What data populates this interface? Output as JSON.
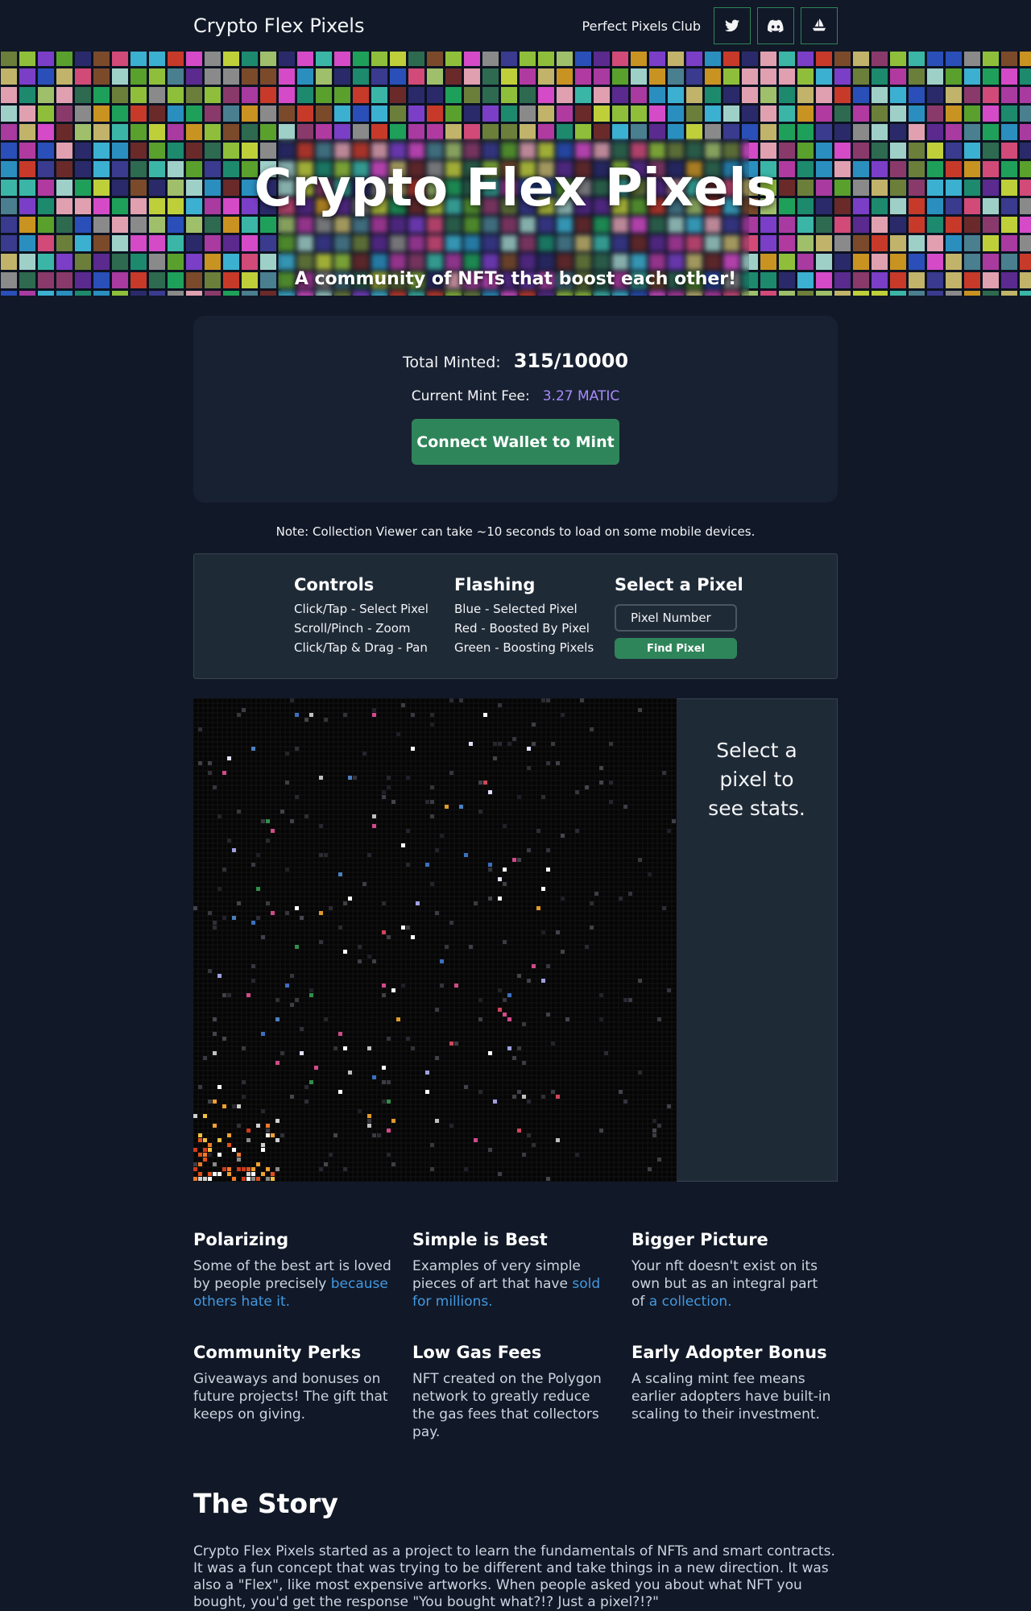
{
  "nav": {
    "brand": "Crypto Flex Pixels",
    "club_label": "Perfect Pixels Club",
    "icons": [
      "twitter-icon",
      "discord-icon",
      "opensea-icon"
    ]
  },
  "hero": {
    "title": "Crypto Flex Pixels",
    "subtitle": "A community of NFTs that boost each other!"
  },
  "mint": {
    "total_label": "Total Minted:",
    "total_value": "315/10000",
    "fee_label": "Current Mint Fee:",
    "fee_value": "3.27 MATIC",
    "button_label": "Connect Wallet to Mint"
  },
  "note": "Note: Collection Viewer can take ~10 seconds to load on some mobile devices.",
  "controls": {
    "controls_title": "Controls",
    "controls_items": [
      "Click/Tap - Select Pixel",
      "Scroll/Pinch - Zoom",
      "Click/Tap & Drag - Pan"
    ],
    "flashing_title": "Flashing",
    "flashing_items": [
      "Blue - Selected Pixel",
      "Red - Boosted By Pixel",
      "Green - Boosting Pixels"
    ],
    "select_title": "Select a Pixel",
    "input_placeholder": "Pixel Number",
    "find_label": "Find Pixel"
  },
  "viewer": {
    "stats_placeholder": "Select a pixel to see stats."
  },
  "features": [
    {
      "title": "Polarizing",
      "text": "Some of the best art is loved by people precisely ",
      "link": "because others hate it."
    },
    {
      "title": "Simple is Best",
      "text": "Examples of very simple pieces of art that have ",
      "link": "sold for millions."
    },
    {
      "title": "Bigger Picture",
      "text": "Your nft doesn't exist on its own but as an integral part of ",
      "link": "a collection."
    },
    {
      "title": "Community Perks",
      "text": "Giveaways and bonuses on future projects! The gift that keeps on giving.",
      "link": ""
    },
    {
      "title": "Low Gas Fees",
      "text": "NFT created on the Polygon network to greatly reduce the gas fees that collectors pay.",
      "link": ""
    },
    {
      "title": "Early Adopter Bonus",
      "text": "A scaling mint fee means earlier adopters have built-in scaling to their investment.",
      "link": ""
    }
  ],
  "story": {
    "title": "The Story",
    "text": "Crypto Flex Pixels started as a project to learn the fundamentals of NFTs and smart contracts. It was a fun concept that was trying to be different and take things in a new direction. It was also a \"Flex\", like most expensive artworks. When people asked you about what NFT you bought, you'd get the response \"You bought what?!? Just a pixel?!?\""
  },
  "colors": {
    "accent_green": "#2f855a",
    "fee_purple": "#a78bfa",
    "link_blue": "#4299e1",
    "background": "#111827"
  }
}
